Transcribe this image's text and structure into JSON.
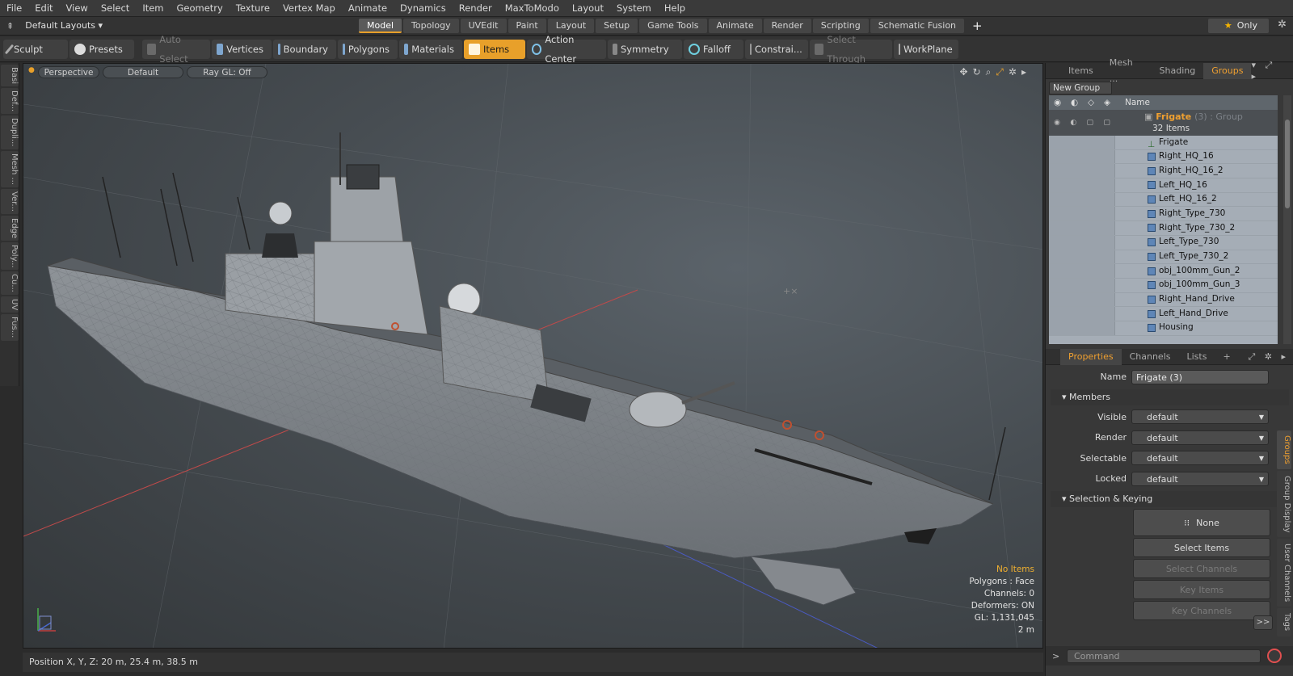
{
  "menu": [
    "File",
    "Edit",
    "View",
    "Select",
    "Item",
    "Geometry",
    "Texture",
    "Vertex Map",
    "Animate",
    "Dynamics",
    "Render",
    "MaxToModo",
    "Layout",
    "System",
    "Help"
  ],
  "layout_selector": "Default Layouts",
  "layout_tabs": [
    "Model",
    "Topology",
    "UVEdit",
    "Paint",
    "Layout",
    "Setup",
    "Game Tools",
    "Animate",
    "Render",
    "Scripting",
    "Schematic Fusion"
  ],
  "layout_active": "Model",
  "only_label": "Only",
  "toolbar": [
    {
      "label": "Sculpt",
      "state": "normal"
    },
    {
      "label": "Presets",
      "state": "normal"
    },
    {
      "label": "Auto Select",
      "state": "dim"
    },
    {
      "label": "Vertices",
      "state": "normal"
    },
    {
      "label": "Boundary",
      "state": "normal"
    },
    {
      "label": "Polygons",
      "state": "normal"
    },
    {
      "label": "Materials",
      "state": "normal"
    },
    {
      "label": "Items",
      "state": "on"
    },
    {
      "label": "Action Center",
      "state": "normal"
    },
    {
      "label": "Symmetry",
      "state": "normal"
    },
    {
      "label": "Falloff",
      "state": "normal"
    },
    {
      "label": "Constrai...",
      "state": "normal"
    },
    {
      "label": "Select Through",
      "state": "dim"
    },
    {
      "label": "WorkPlane",
      "state": "normal"
    }
  ],
  "left_tabs": [
    "Basi",
    "Def...",
    "Dupli...",
    "Mesh ...",
    "Ver...",
    "Edge",
    "Poly...",
    "Cu...",
    "UV",
    "Fus..."
  ],
  "viewport": {
    "view_mode": "Perspective",
    "shading": "Default",
    "raygl": "Ray GL: Off",
    "stats": {
      "selection": "No Items",
      "polygons": "Polygons : Face",
      "channels": "Channels: 0",
      "deformers": "Deformers: ON",
      "gl": "GL: 1,131,045",
      "scale": "2 m"
    }
  },
  "status": "Position X, Y, Z:  20 m, 25.4 m, 38.5 m",
  "right_tabs": [
    "Items",
    "Mesh ...",
    "Shading",
    "Groups"
  ],
  "right_tab_active": "Groups",
  "new_group": "New Group",
  "tree": {
    "header": "Name",
    "group_name": "Frigate",
    "group_suffix": "(3) : Group",
    "group_count": "32 Items",
    "items": [
      "Frigate",
      "Right_HQ_16",
      "Right_HQ_16_2",
      "Left_HQ_16",
      "Left_HQ_16_2",
      "Right_Type_730",
      "Right_Type_730_2",
      "Left_Type_730",
      "Left_Type_730_2",
      "obj_100mm_Gun_2",
      "obj_100mm_Gun_3",
      "Right_Hand_Drive",
      "Left_Hand_Drive",
      "Housing"
    ]
  },
  "prop_tabs": [
    "Properties",
    "Channels",
    "Lists"
  ],
  "props": {
    "name_label": "Name",
    "name_value": "Frigate (3)",
    "members": "Members",
    "fields": [
      {
        "label": "Visible",
        "value": "default"
      },
      {
        "label": "Render",
        "value": "default"
      },
      {
        "label": "Selectable",
        "value": "default"
      },
      {
        "label": "Locked",
        "value": "default"
      }
    ],
    "sel_keying": "Selection & Keying",
    "none_btn": "None",
    "select_items": "Select Items",
    "select_channels": "Select Channels",
    "key_items": "Key Items",
    "key_channels": "Key Channels",
    "more": ">>"
  },
  "group_tabs": [
    "Groups",
    "Group Display",
    "User Channels",
    "Tags"
  ],
  "command_placeholder": "Command",
  "colors": {
    "accent": "#e8a02a",
    "tree_bg": "#a5adb6"
  }
}
